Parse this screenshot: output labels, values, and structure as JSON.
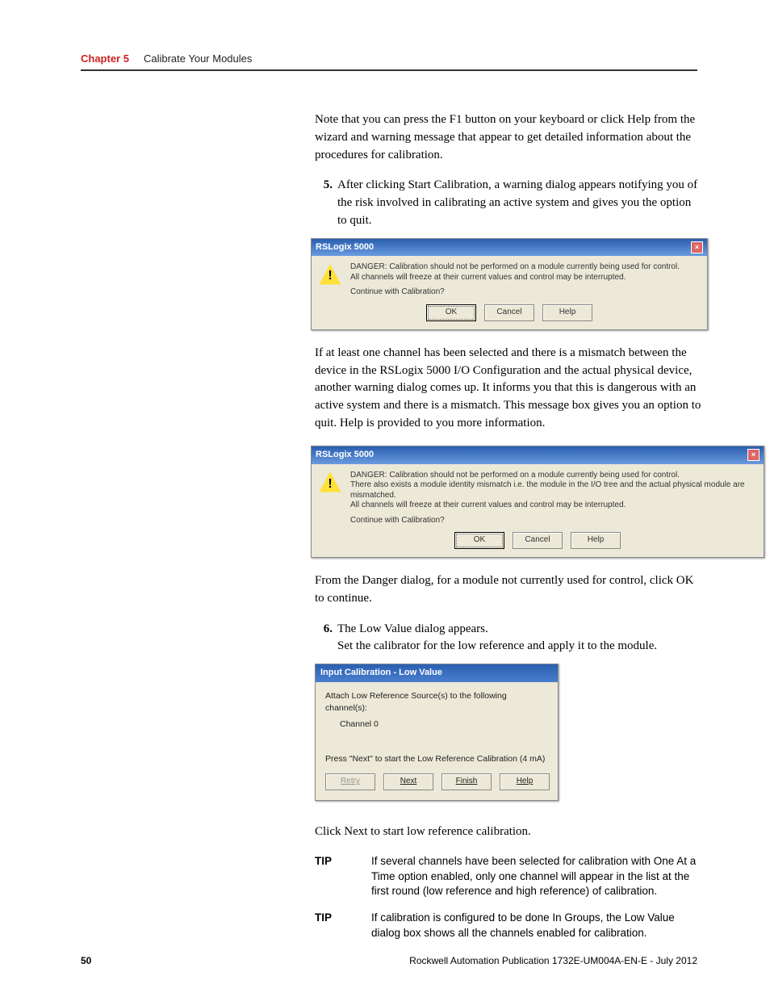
{
  "header": {
    "chapter": "Chapter 5",
    "title": "Calibrate Your Modules"
  },
  "p1": "Note that you can press the F1 button on your keyboard or click Help from the wizard and warning message that appear to get detailed information about the procedures for calibration.",
  "step5": {
    "num": "5.",
    "text": "After clicking Start Calibration, a warning dialog appears notifying you of the risk involved in calibrating an active system and gives you the option to quit."
  },
  "dlg1": {
    "title": "RSLogix 5000",
    "msg1": "DANGER: Calibration should not be performed on a module currently being used for control.",
    "msg2": "All channels will freeze at their current values and control may be interrupted.",
    "prompt": "Continue with Calibration?",
    "ok": "OK",
    "cancel": "Cancel",
    "help": "Help"
  },
  "p2": "If at least one channel has been selected and there is a mismatch between the device in the RSLogix 5000 I/O Configuration and the actual physical device, another warning dialog comes up. It informs you that this is dangerous with an active system and there is a mismatch. This message box gives you an option to quit. Help is provided to you more information.",
  "dlg2": {
    "title": "RSLogix 5000",
    "msg1": "DANGER: Calibration should not be performed on a module currently being used for control.",
    "msg2": "There also exists a module identity mismatch i.e. the module in the I/O tree and the actual physical module are mismatched.",
    "msg3": "All channels will freeze at their current values and control may be interrupted.",
    "prompt": "Continue with Calibration?",
    "ok": "OK",
    "cancel": "Cancel",
    "help": "Help"
  },
  "p3": "From the Danger dialog, for a module not currently used for control, click OK to continue.",
  "step6": {
    "num": "6.",
    "a": "The Low Value dialog appears.",
    "b": "Set the calibrator for the low reference and apply it to the module."
  },
  "idlg": {
    "title": "Input Calibration - Low Value",
    "attach": "Attach Low Reference Source(s) to  the following channel(s):",
    "channel": "Channel 0",
    "press": "Press \"Next\" to start the Low Reference Calibration  (4 mA)",
    "retry": "Retry",
    "next": "Next",
    "finish": "Finish",
    "help": "Help"
  },
  "p4": "Click Next to start low reference calibration.",
  "tip1": {
    "label": "TIP",
    "text": "If several channels have been selected for calibration with One At a Time option enabled, only one channel will appear in the list at the first round (low reference and high reference) of calibration."
  },
  "tip2": {
    "label": "TIP",
    "text": "If calibration is configured to be done In Groups, the Low Value dialog box shows all the channels enabled for calibration."
  },
  "footer": {
    "page": "50",
    "pub": "Rockwell Automation Publication 1732E-UM004A-EN-E - July 2012"
  }
}
